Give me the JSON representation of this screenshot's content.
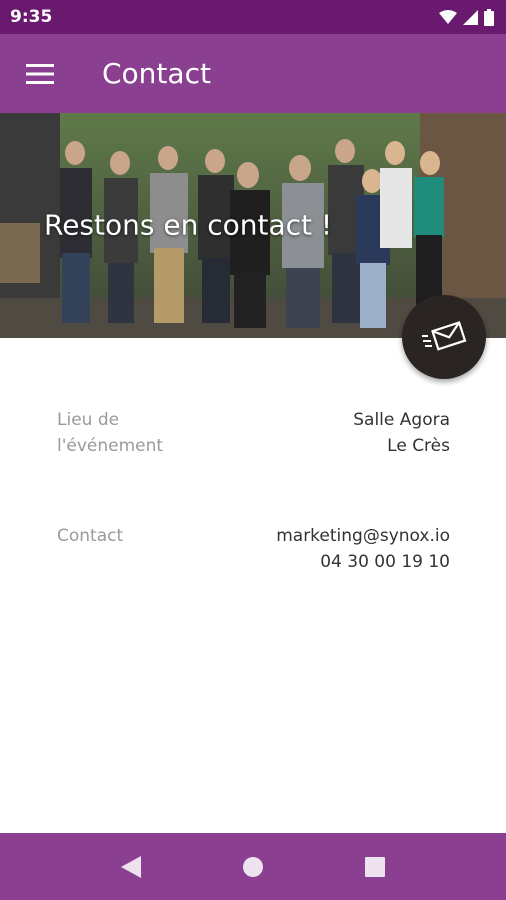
{
  "status_bar": {
    "time": "9:35"
  },
  "app_bar": {
    "title": "Contact",
    "menu_icon": "hamburger-menu-icon"
  },
  "hero": {
    "title": "Restons en contact !"
  },
  "fab": {
    "icon": "envelope-send-icon"
  },
  "details": [
    {
      "label": "Lieu de l'événement",
      "values": [
        "Salle Agora",
        "Le Crès"
      ]
    },
    {
      "label": "Contact",
      "values": [
        "marketing@synox.io",
        "04 30 00 19 10"
      ]
    }
  ],
  "colors": {
    "primary": "#8a3f91",
    "status_bar": "#6a1a6e",
    "fab": "#2a2523"
  }
}
